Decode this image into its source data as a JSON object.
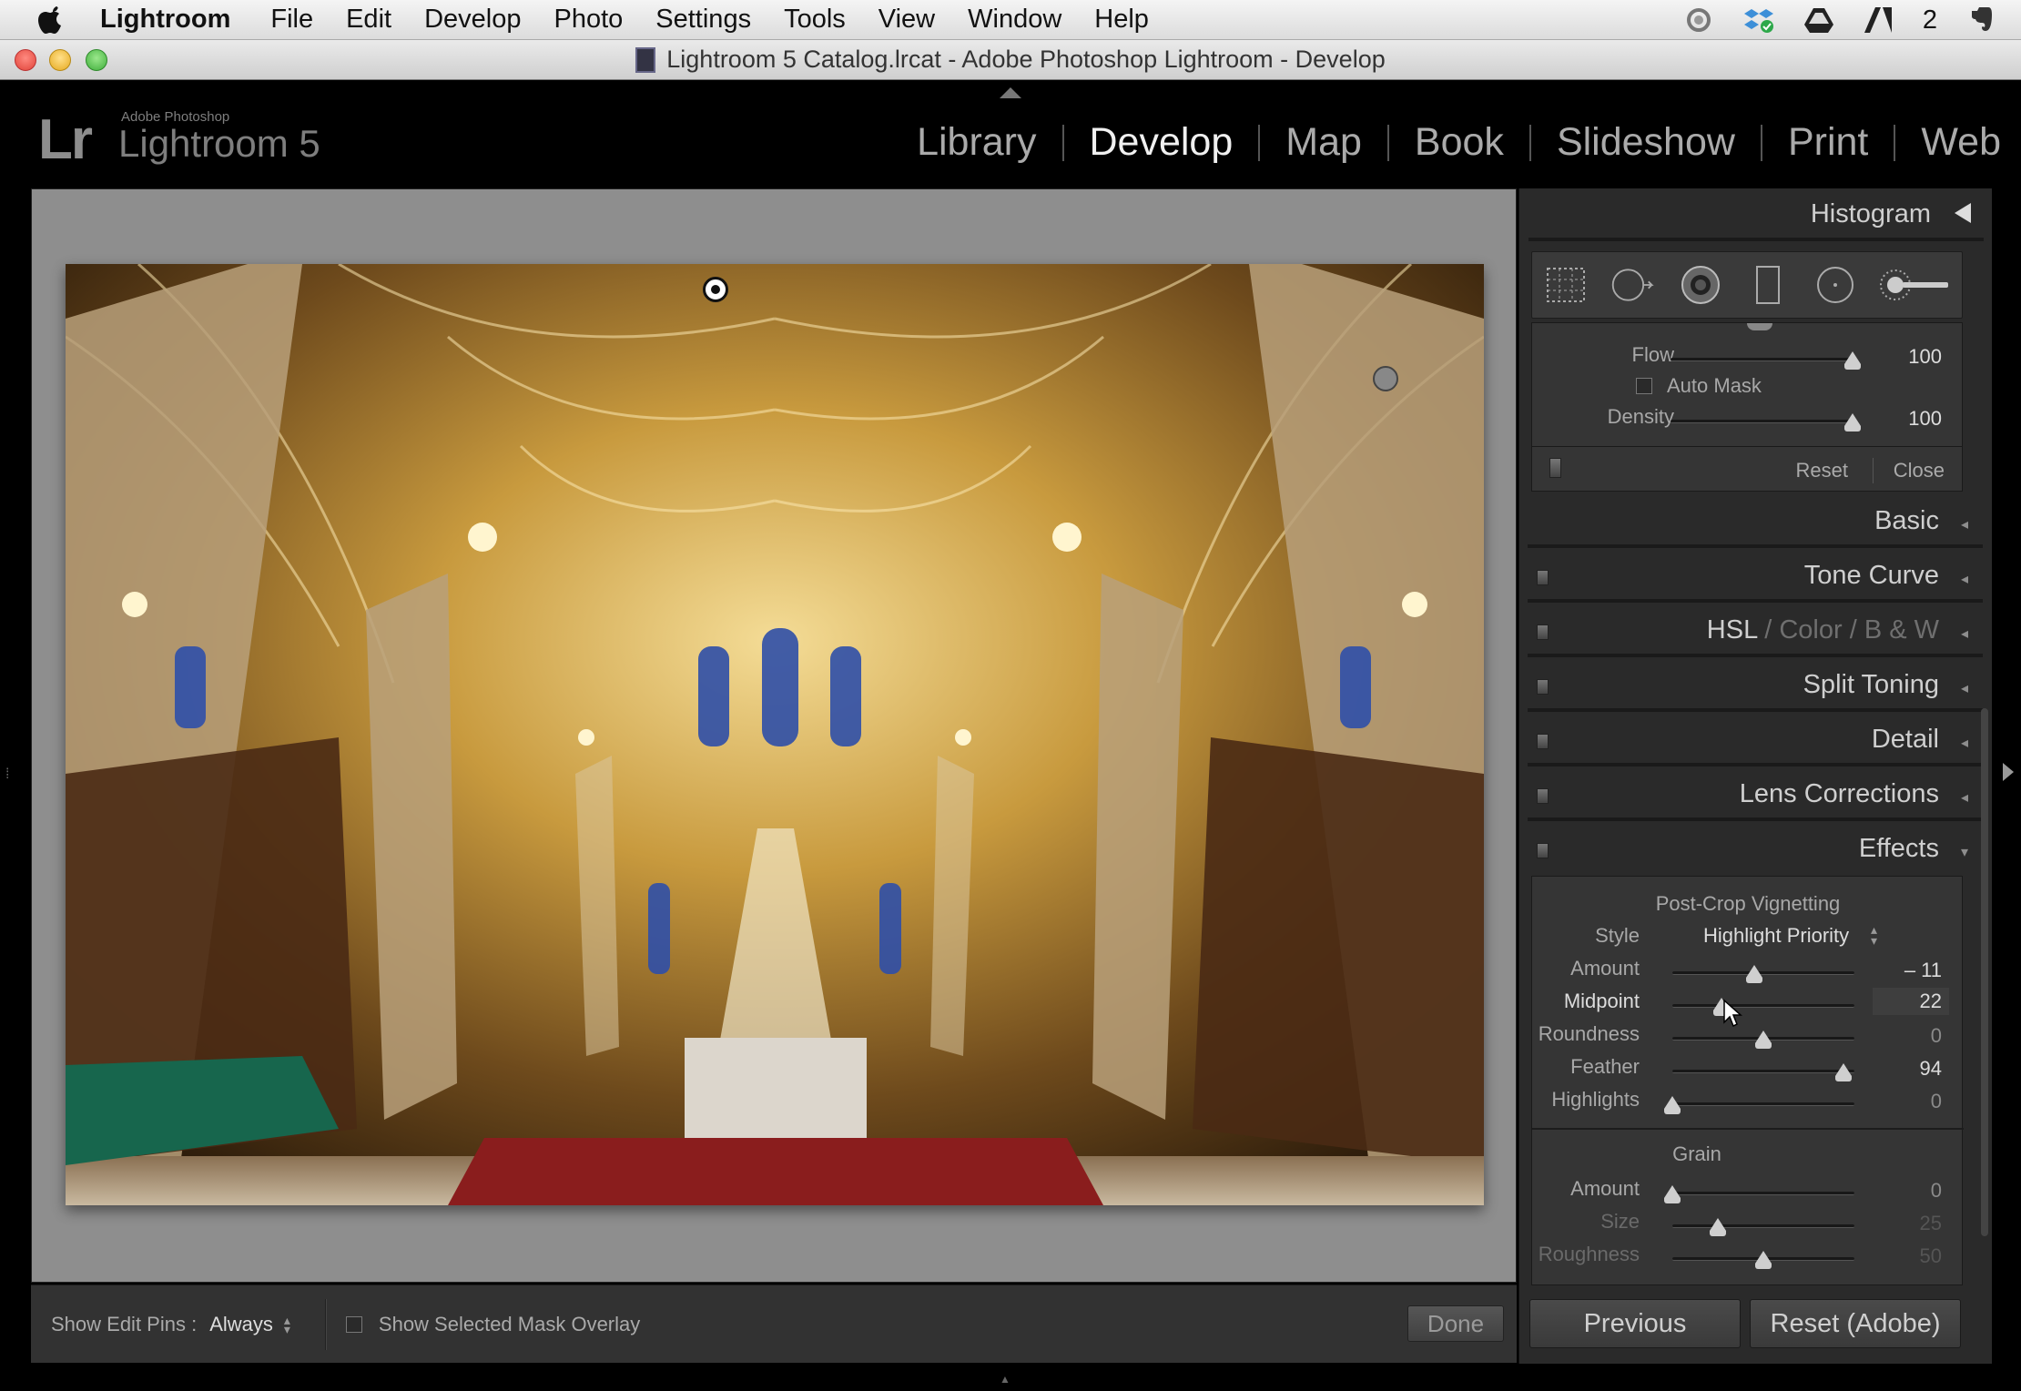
{
  "menubar": {
    "app": "Lightroom",
    "items": [
      "File",
      "Edit",
      "Develop",
      "Photo",
      "Settings",
      "Tools",
      "View",
      "Window",
      "Help"
    ],
    "status_count": "2"
  },
  "window": {
    "title": "Lightroom 5 Catalog.lrcat - Adobe Photoshop Lightroom - Develop"
  },
  "identity": {
    "logo": "Lr",
    "small": "Adobe Photoshop",
    "name": "Lightroom 5"
  },
  "modules": [
    "Library",
    "Develop",
    "Map",
    "Book",
    "Slideshow",
    "Print",
    "Web"
  ],
  "active_module": "Develop",
  "toolbar": {
    "pins_label": "Show Edit Pins :",
    "pins_value": "Always",
    "mask_overlay_label": "Show Selected Mask Overlay",
    "done_label": "Done"
  },
  "panel": {
    "histogram_label": "Histogram",
    "brush": {
      "flow_label": "Flow",
      "flow_value": "100",
      "flow_level": 1.0,
      "automask_label": "Auto Mask",
      "density_label": "Density",
      "density_value": "100",
      "density_level": 1.0,
      "reset_label": "Reset",
      "close_label": "Close"
    },
    "sections": {
      "basic": "Basic",
      "tone_curve": "Tone Curve",
      "hsl": "HSL",
      "color": "Color",
      "bw": "B & W",
      "split_toning": "Split Toning",
      "detail": "Detail",
      "lens_corrections": "Lens Corrections",
      "effects": "Effects"
    },
    "vignette": {
      "title": "Post-Crop Vignetting",
      "style_label": "Style",
      "style_value": "Highlight Priority",
      "amount_label": "Amount",
      "amount_value": "– 11",
      "amount_level": 0.45,
      "midpoint_label": "Midpoint",
      "midpoint_value": "22",
      "midpoint_level": 0.27,
      "roundness_label": "Roundness",
      "roundness_value": "0",
      "roundness_level": 0.5,
      "feather_label": "Feather",
      "feather_value": "94",
      "feather_level": 0.94,
      "highlights_label": "Highlights",
      "highlights_value": "0",
      "highlights_level": 0.0
    },
    "grain": {
      "title": "Grain",
      "amount_label": "Amount",
      "amount_value": "0",
      "amount_level": 0.0,
      "size_label": "Size",
      "size_value": "25",
      "size_level": 0.25,
      "roughness_label": "Roughness",
      "roughness_value": "50",
      "roughness_level": 0.5
    }
  },
  "buttons": {
    "previous": "Previous",
    "reset": "Reset (Adobe)"
  },
  "colors": {
    "panel_bg": "#2a2a2a",
    "image_bg": "#8e8e8e",
    "active_text": "#f0f0f0"
  }
}
